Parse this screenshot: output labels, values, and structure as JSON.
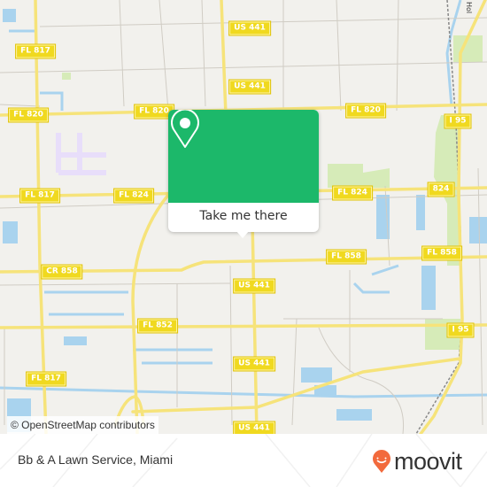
{
  "map": {
    "colors": {
      "background": "#f2f1ed",
      "road_major": "#f6e37a",
      "water": "#a9d3ee",
      "park": "#d6ebb8",
      "shield": "#f0d91f"
    },
    "road_shields": [
      {
        "id": "fl817-nw",
        "label": "FL 817"
      },
      {
        "id": "us441-n1",
        "label": "US 441"
      },
      {
        "id": "us441-n2",
        "label": "US 441"
      },
      {
        "id": "fl820-w",
        "label": "FL 820"
      },
      {
        "id": "fl820-c",
        "label": "FL 820"
      },
      {
        "id": "fl820-e",
        "label": "FL 820"
      },
      {
        "id": "i95-n",
        "label": "I 95"
      },
      {
        "id": "fl817-w",
        "label": "FL 817"
      },
      {
        "id": "fl824-w",
        "label": "FL 824"
      },
      {
        "id": "fl824-e",
        "label": "FL 824"
      },
      {
        "id": "824-e",
        "label": "824"
      },
      {
        "id": "cr858",
        "label": "CR 858"
      },
      {
        "id": "fl858-c",
        "label": "FL 858"
      },
      {
        "id": "fl858-e",
        "label": "FL 858"
      },
      {
        "id": "us441-c",
        "label": "US 441"
      },
      {
        "id": "fl852",
        "label": "FL 852"
      },
      {
        "id": "i95-s",
        "label": "I 95"
      },
      {
        "id": "us441-s1",
        "label": "US 441"
      },
      {
        "id": "fl817-sw",
        "label": "FL 817"
      },
      {
        "id": "us441-s2",
        "label": "US 441"
      }
    ],
    "corner_label": "Hol",
    "attribution": "© OpenStreetMap contributors"
  },
  "popup": {
    "button_label": "Take me there",
    "icon": "location-pin-icon",
    "color": "#1cb86a"
  },
  "footer": {
    "place_name": "Bb & A Lawn Service, Miami",
    "brand": "moovit",
    "brand_color": "#f26a3d"
  }
}
